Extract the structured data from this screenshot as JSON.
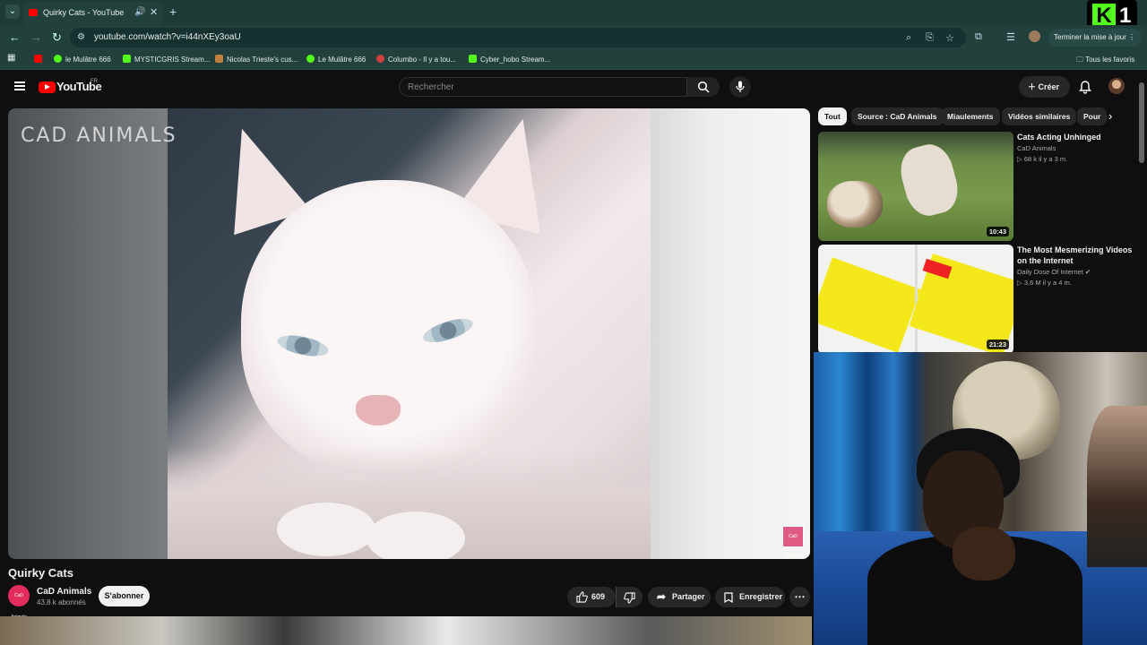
{
  "browser": {
    "tab_title": "Quirky Cats - YouTube",
    "url": "youtube.com/watch?v=i44nXEy3oaU",
    "update_button": "Terminer la mise à jour",
    "bookmarks": [
      {
        "label": "",
        "color": "#ff0000"
      },
      {
        "label": "le Mulâtre 666",
        "color": "#53fc18"
      },
      {
        "label": "MYSTICGRIS Stream...",
        "color": "#53fc18"
      },
      {
        "label": "Nicolas Trieste's cus...",
        "color": "#c08040"
      },
      {
        "label": "Le Mulâtre 666",
        "color": "#53fc18"
      },
      {
        "label": "Columbo - Il y a tou...",
        "color": "#d04040"
      },
      {
        "label": "Cyber_hobo Stream...",
        "color": "#53fc18"
      }
    ],
    "all_bookmarks": "Tous les favoris"
  },
  "overlay_logo": {
    "k": "K",
    "num": "1"
  },
  "youtube": {
    "logo_text": "YouTube",
    "region": "FR",
    "search_placeholder": "Rechercher",
    "create_label": "Créer"
  },
  "video": {
    "watermark": "CAD ANIMALS",
    "title": "Quirky Cats",
    "channel": "CaD Animals",
    "subscribers": "43,8 k abonnés",
    "subscribe_label": "S'abonner",
    "likes": "609",
    "share_label": "Partager",
    "save_label": "Enregistrer",
    "badge_text": "CaD Animals"
  },
  "chips": [
    "Tout",
    "Source : CaD Animals",
    "Miaulements",
    "Vidéos similaires",
    "Pour"
  ],
  "recommendations": [
    {
      "title": "Cats Acting Unhinged",
      "channel": "CaD Animals",
      "views": "68 k",
      "age": "il y a 3 m.",
      "duration": "10:43"
    },
    {
      "title": "The Most Mesmerizing Videos on the Internet",
      "channel": "Daily Dose Of Internet",
      "views": "3,6 M",
      "age": "il y a 4 m.",
      "duration": "21:23"
    }
  ],
  "colors": {
    "accent": "#ff0000",
    "kick_green": "#53fc18",
    "bg": "#0f0f0f"
  }
}
